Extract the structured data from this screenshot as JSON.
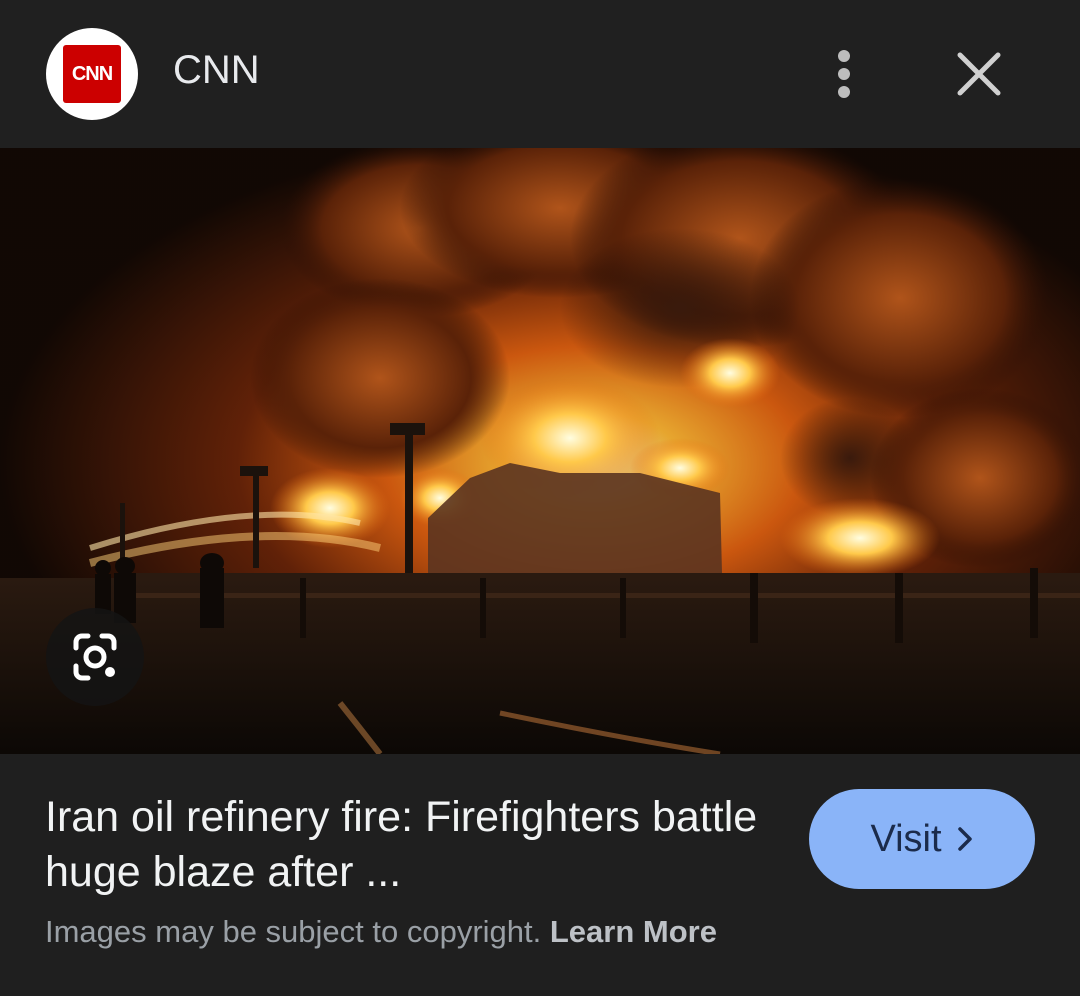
{
  "header": {
    "logo_text": "CNN",
    "source_name": "CNN",
    "more_icon": "more-vert-icon",
    "close_icon": "close-icon"
  },
  "image": {
    "lens_icon": "google-lens-icon"
  },
  "article": {
    "title": "Iran oil refinery fire: Firefighters battle huge blaze after ...",
    "visit_label": "Visit",
    "visit_icon": "chevron-right-icon"
  },
  "footer": {
    "copyright_text": "Images may be subject to copyright.",
    "learn_more": "Learn More"
  },
  "colors": {
    "background": "#1f1f1f",
    "accent": "#8ab4f8",
    "brand": "#cc0000"
  }
}
